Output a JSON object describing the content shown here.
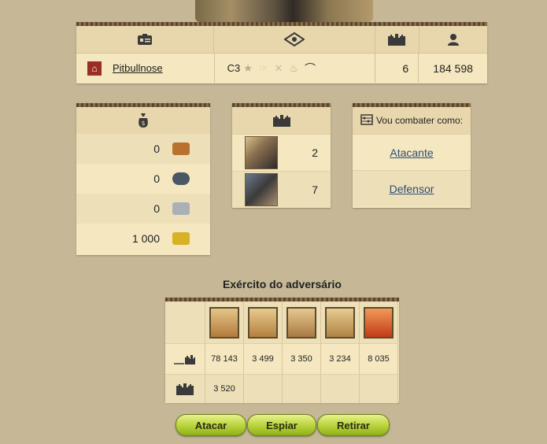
{
  "player": {
    "name": "Pitbullnose",
    "continent": "C3",
    "cities": "6",
    "points": "184 598"
  },
  "resources": [
    {
      "value": "0",
      "icon": "wood-icon",
      "color": "#b8722e"
    },
    {
      "value": "0",
      "icon": "stone-icon",
      "color": "#4a5866"
    },
    {
      "value": "0",
      "icon": "iron-icon",
      "color": "#aab0b6"
    },
    {
      "value": "1 000",
      "icon": "gold-icon",
      "color": "#d8b124"
    }
  ],
  "buildings": [
    {
      "value": "2",
      "icon": "wall-thumbnail"
    },
    {
      "value": "7",
      "icon": "tower-thumbnail"
    }
  ],
  "role": {
    "header": "Vou combater como:",
    "attacker": "Atacante",
    "defender": "Defensor"
  },
  "army": {
    "title": "Exército do adversário",
    "units": [
      {
        "icon": "swordsman-icon",
        "home": "78 143",
        "support": "3 520"
      },
      {
        "icon": "hoplite-icon",
        "home": "3 499",
        "support": ""
      },
      {
        "icon": "horseman-icon",
        "home": "3 350",
        "support": ""
      },
      {
        "icon": "chariot-icon",
        "home": "3 234",
        "support": ""
      },
      {
        "icon": "myth-unit-icon",
        "home": "8 035",
        "support": ""
      }
    ]
  },
  "buttons": {
    "attack": "Atacar",
    "spy": "Espiar",
    "retreat": "Retirar"
  }
}
